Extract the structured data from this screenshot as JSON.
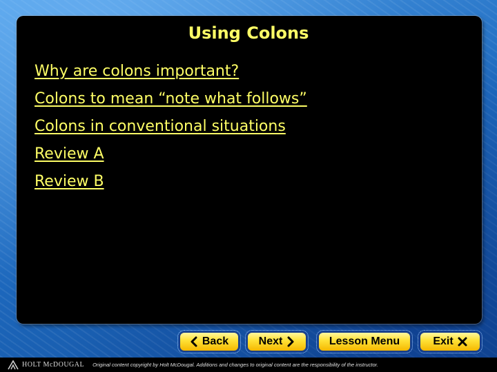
{
  "slide": {
    "title": "Using Colons",
    "links": [
      "Why are colons important?",
      "Colons to mean “note what follows”",
      "Colons in conventional situations",
      "Review A",
      "Review B"
    ]
  },
  "navigation": {
    "back_label": "Back",
    "next_label": "Next",
    "lesson_menu_label": "Lesson Menu",
    "exit_label": "Exit"
  },
  "footer": {
    "publisher": "HOLT McDOUGAL",
    "copyright": "Original content copyright by Holt McDougal. Additions and changes to original content are the responsibility of the instructor."
  },
  "colors": {
    "link": "#ffff66",
    "panel": "#000000",
    "button_fill": "#ffe33a",
    "background": "#1f6fc4"
  },
  "icons": {
    "back": "chevron-left-icon",
    "next": "chevron-right-icon",
    "exit": "close-icon",
    "logo": "holt-mcdougal-logo-icon"
  }
}
